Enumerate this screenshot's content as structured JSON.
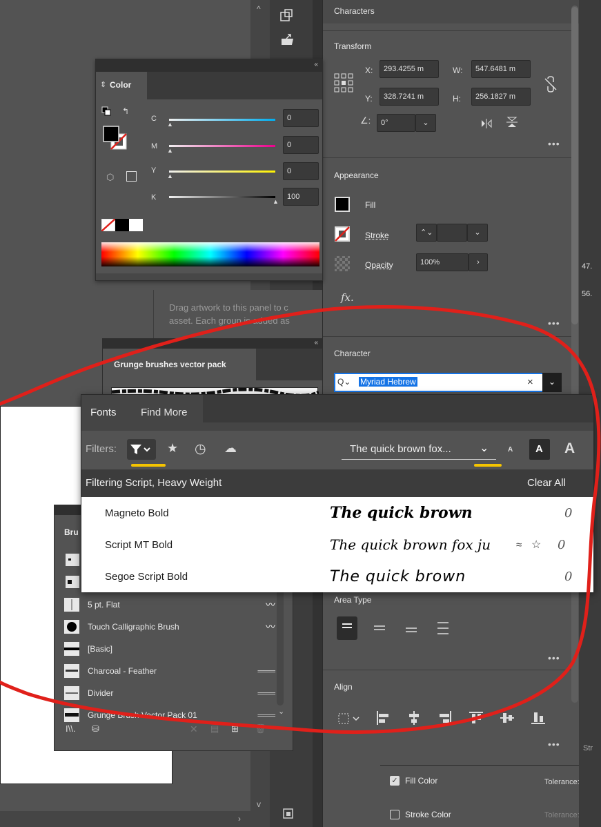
{
  "properties": {
    "characters_label": "Characters",
    "transform": {
      "title": "Transform",
      "x_label": "X:",
      "x_value": "293.4255 m",
      "y_label": "Y:",
      "y_value": "328.7241 m",
      "w_label": "W:",
      "w_value": "547.6481 m",
      "h_label": "H:",
      "h_value": "256.1827 m",
      "angle_value": "0°"
    },
    "appearance": {
      "title": "Appearance",
      "fill_label": "Fill",
      "stroke_label": "Stroke",
      "opacity_label": "Opacity",
      "opacity_value": "100%",
      "fx_label": "fx."
    },
    "character": {
      "title": "Character",
      "font_search_value": "Myriad Hebrew"
    },
    "area_type": {
      "title": "Area Type"
    },
    "align": {
      "title": "Align"
    },
    "fill_color_label": "Fill Color",
    "stroke_color_label": "Stroke Color",
    "tolerance_label": "Tolerance:",
    "tolerance_label_2": "Tolerance:",
    "edge_numbers": [
      "47.",
      "56."
    ],
    "str_fragment": "Str"
  },
  "color_panel": {
    "title": "Color",
    "channels": [
      {
        "name": "C",
        "value": "0"
      },
      {
        "name": "M",
        "value": "0"
      },
      {
        "name": "Y",
        "value": "0"
      },
      {
        "name": "K",
        "value": "100"
      }
    ]
  },
  "assets_hint": {
    "line1": "Drag artwork to this panel to c",
    "line2": "asset. Each group is added as"
  },
  "grunge": {
    "title": "Grunge brushes vector pack"
  },
  "brushes_panel": {
    "title": "Bru",
    "items": [
      {
        "label": "5 pt. Flat"
      },
      {
        "label": "Touch Calligraphic Brush"
      },
      {
        "label": "[Basic]"
      },
      {
        "label": "Charcoal - Feather"
      },
      {
        "label": "Divider"
      },
      {
        "label": "Grunge Brush Vector Pack 01"
      }
    ]
  },
  "fonts_popup": {
    "tabs": [
      "Fonts",
      "Find More"
    ],
    "filters_label": "Filters:",
    "sample_text": "The quick brown fox...",
    "size_small": "A",
    "size_med": "A",
    "size_large": "A",
    "filtering_text": "Filtering Script, Heavy Weight",
    "clear_all": "Clear All",
    "fonts": [
      {
        "name": "Magneto Bold",
        "preview": "The quick brown",
        "count": "0"
      },
      {
        "name": "Script MT Bold",
        "preview": "The quick brown fox ju",
        "count": "0"
      },
      {
        "name": "Segoe Script Bold",
        "preview": "The quick brown",
        "count": "0"
      }
    ]
  },
  "colors": {
    "annotation_red": "#e0201a",
    "highlight_yellow": "#f5c400",
    "selection_blue": "#1473e6"
  }
}
